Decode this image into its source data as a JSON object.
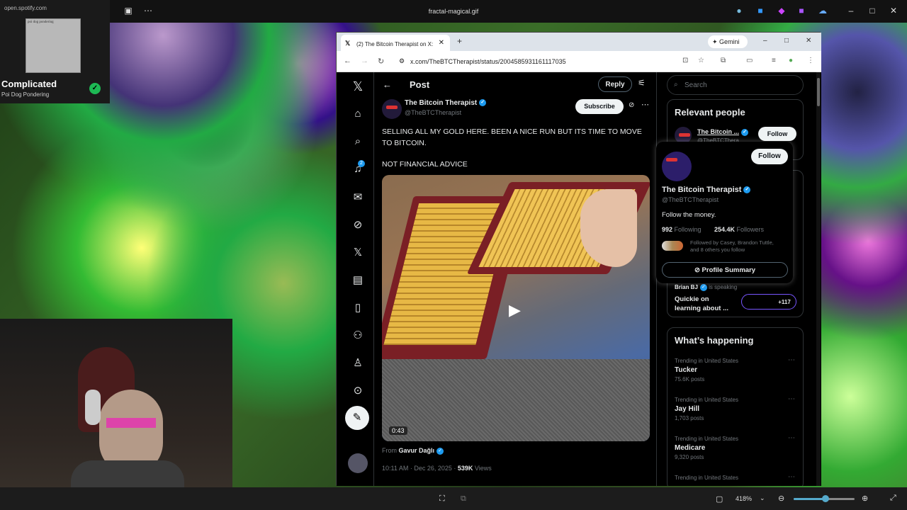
{
  "window": {
    "title": "fractal-magical.gif",
    "zoom": "418%"
  },
  "spotify": {
    "url": "open.spotify.com",
    "cover_text": "poi dog pondering",
    "song": "Complicated",
    "artist": "Poi Dog Pondering"
  },
  "browser": {
    "tab_title": "(2) The Bitcoin Therapist on X:",
    "gemini": "Gemini",
    "url": "x.com/TheBTCTherapist/status/2004585931161117035"
  },
  "nav": {
    "notifications_badge": "2"
  },
  "post": {
    "header": "Post",
    "reply": "Reply",
    "author_name": "The Bitcoin Therapist",
    "author_handle": "@TheBTCTherapist",
    "subscribe": "Subscribe",
    "text1": "SELLING ALL MY GOLD HERE. BEEN A NICE RUN BUT ITS TIME TO MOVE TO BITCOIN.",
    "text2": "NOT FINANCIAL ADVICE",
    "duration": "0:43",
    "from_label": "From",
    "from_name": "Gavur Dağlı",
    "time": "10:11 AM · Dec 26, 2025 · ",
    "views_count": "539K",
    "views_label": " Views"
  },
  "sidebar": {
    "search_placeholder": "Search",
    "relevant_title": "Relevant people",
    "rp_name": "The Bitcoin ...",
    "rp_handle": "@TheBTCThera...",
    "follow": "Follow",
    "space_host": "Brian BJ",
    "space_status": "is speaking",
    "space_title": "Quickie on learning about ...",
    "space_count": "+117",
    "happening_title": "What’s happening",
    "trends": [
      {
        "ctx": "Trending in United States",
        "name": "Tucker",
        "posts": "75.6K posts"
      },
      {
        "ctx": "Trending in United States",
        "name": "Jay Hill",
        "posts": "1,703 posts"
      },
      {
        "ctx": "Trending in United States",
        "name": "Medicare",
        "posts": "9,320 posts"
      },
      {
        "ctx": "Trending in United States",
        "name": "",
        "posts": ""
      }
    ]
  },
  "hovercard": {
    "follow": "Follow",
    "name": "The Bitcoin Therapist",
    "handle": "@TheBTCTherapist",
    "bio": "Follow the money.",
    "following_count": "992",
    "following_label": " Following",
    "followers_count": "254.4K",
    "followers_label": " Followers",
    "followed_by": "Followed by Casey, Brandon Tuttle, and 8 others you follow",
    "summary": "Profile Summary"
  }
}
